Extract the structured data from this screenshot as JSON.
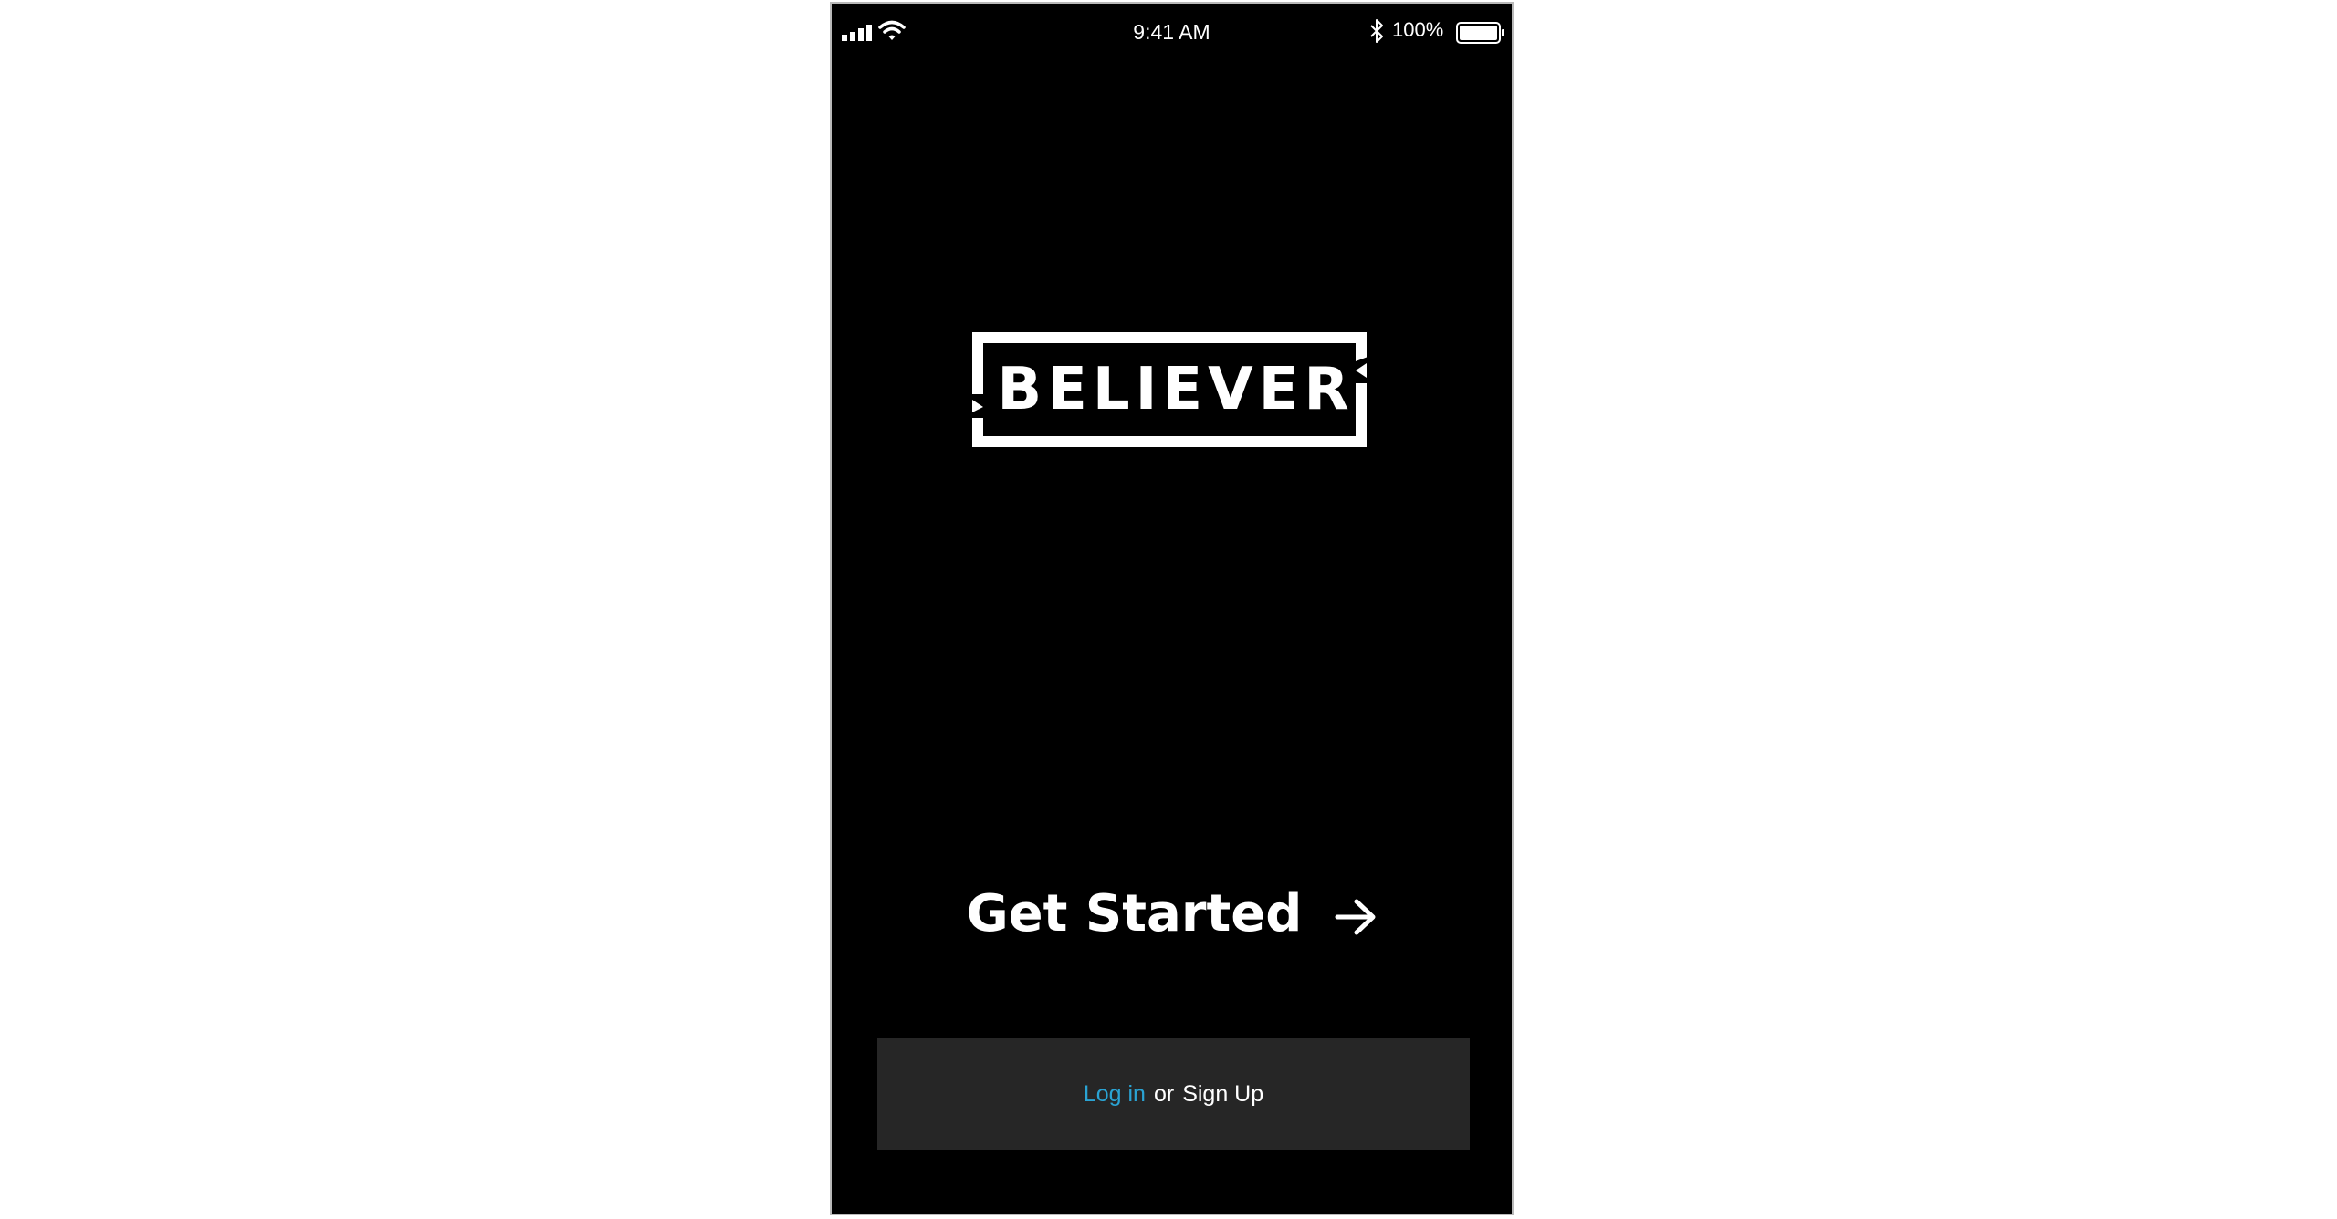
{
  "status_bar": {
    "time": "9:41 AM",
    "battery_percent": "100%",
    "icons": {
      "signal": "signal-bars-icon",
      "wifi": "wifi-icon",
      "bluetooth": "bluetooth-icon",
      "battery": "battery-icon"
    },
    "battery_level": 1.0
  },
  "logo": {
    "text": "BELIEVER"
  },
  "cta": {
    "label": "Get Started",
    "icon": "arrow-right-icon"
  },
  "auth": {
    "login_label": "Log in",
    "connector": "or",
    "signup_label": "Sign Up"
  },
  "colors": {
    "background": "#000000",
    "text": "#ffffff",
    "link": "#2aa3d3",
    "auth_bar": "#262626"
  }
}
